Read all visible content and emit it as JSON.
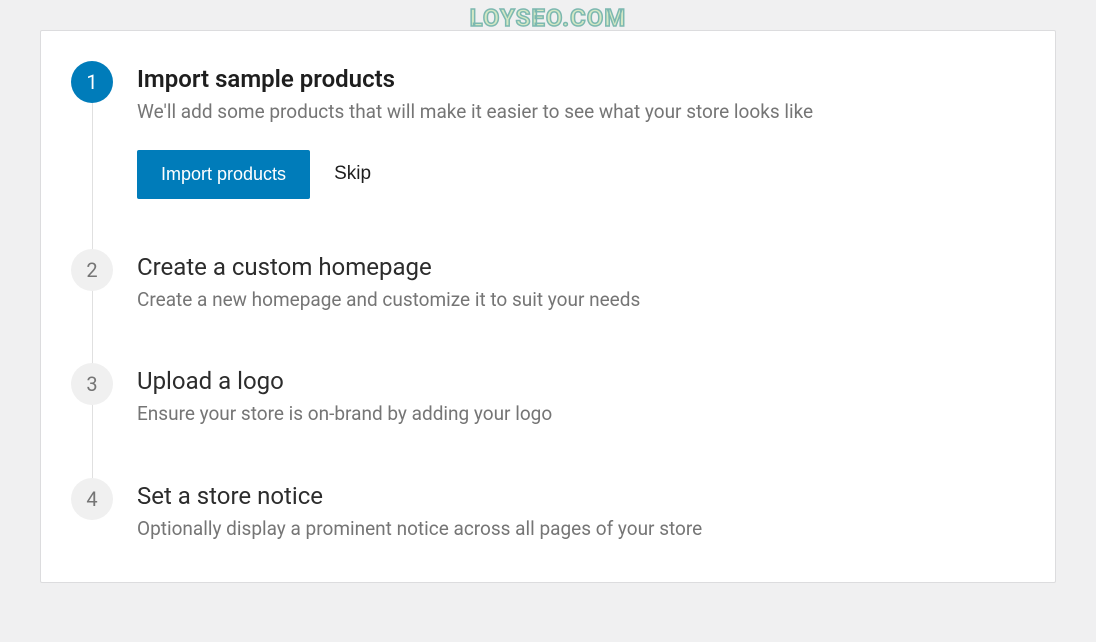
{
  "watermark": "LOYSEO.COM",
  "steps": [
    {
      "number": "1",
      "title": "Import sample products",
      "description": "We'll add some products that will make it easier to see what your store looks like",
      "active": true,
      "actions": {
        "primary": "Import products",
        "secondary": "Skip"
      }
    },
    {
      "number": "2",
      "title": "Create a custom homepage",
      "description": "Create a new homepage and customize it to suit your needs"
    },
    {
      "number": "3",
      "title": "Upload a logo",
      "description": "Ensure your store is on-brand by adding your logo"
    },
    {
      "number": "4",
      "title": "Set a store notice",
      "description": "Optionally display a prominent notice across all pages of your store"
    }
  ]
}
